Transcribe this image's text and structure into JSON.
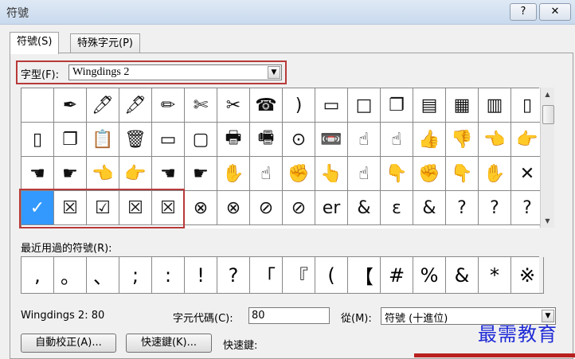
{
  "window": {
    "title": "符號",
    "help_label": "?",
    "close_label": "✕"
  },
  "tabs": [
    {
      "label": "符號(S)"
    },
    {
      "label": "特殊字元(P)"
    }
  ],
  "font": {
    "label": "字型(F):",
    "value": "Wingdings 2"
  },
  "grid_rows": [
    [
      "",
      "✒",
      "🖊",
      "🖋",
      "✏",
      "✄",
      "✂",
      "☎",
      ")",
      "▭",
      "□",
      "❐",
      "▤",
      "▦",
      "▥",
      "▯"
    ],
    [
      "▯",
      "❐",
      "📋",
      "🗑",
      "▭",
      "▢",
      "🖶",
      "🖷",
      "⊙",
      "📼",
      "☝",
      "☝",
      "👍",
      "👎",
      "👈",
      "👉"
    ],
    [
      "☚",
      "☛",
      "👈",
      "👉",
      "☚",
      "☛",
      "✋",
      "☝",
      "✊",
      "👆",
      "☝",
      "👇",
      "✊",
      "👇",
      "✋",
      "✕"
    ],
    [
      "✓",
      "☒",
      "☑",
      "☒",
      "☒",
      "⊗",
      "⊗",
      "⊘",
      "⊘",
      "er",
      "&",
      "ɛ",
      "&",
      "?",
      "?",
      "?"
    ]
  ],
  "selected": {
    "row": 3,
    "col": 0
  },
  "recent": {
    "label": "最近用過的符號(R):",
    "symbols": [
      ",",
      "。",
      "、",
      ";",
      ":",
      "!",
      "?",
      "「",
      "『",
      "(",
      "【",
      "#",
      "%",
      "&",
      "*",
      "※"
    ]
  },
  "info": {
    "char_name": "Wingdings 2: 80",
    "code_label": "字元代碼(C):",
    "code_value": "80",
    "from_label": "從(M):",
    "from_value": "符號 (十進位)"
  },
  "buttons": {
    "autocorrect": "自動校正(A)...",
    "shortcut_key": "快速鍵(K)...",
    "shortcut_label": "快速鍵:"
  },
  "watermark": "最需教育",
  "colors": {
    "highlight": "#b83a3a",
    "selected_cell": "#3399ff",
    "watermark": "#1f2bd6"
  }
}
